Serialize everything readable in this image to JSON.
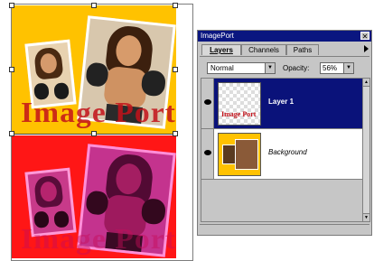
{
  "canvas": {
    "watermark_text": "Image Port"
  },
  "layers_panel": {
    "title": "ImagePort",
    "close_glyph": "✕",
    "tabs": [
      {
        "label": "Layers",
        "active": true
      },
      {
        "label": "Channels",
        "active": false
      },
      {
        "label": "Paths",
        "active": false
      }
    ],
    "menu_icon": "palette-menu-arrow-icon",
    "blend_mode": "Normal",
    "opacity_label": "Opacity:",
    "opacity_value": "56%",
    "layers": [
      {
        "name": "Layer 1",
        "selected": true,
        "visible": true,
        "thumb_text": "Image Port"
      },
      {
        "name": "Background",
        "selected": false,
        "visible": true
      }
    ]
  },
  "colors": {
    "top_layer_bg": "#ffc200",
    "bottom_layer_bg": "#ff1616",
    "watermark_top": "#c4121a",
    "watermark_bottom": "#c80d5a",
    "title_bar": "#0a1680",
    "selected_row": "#0a127a"
  }
}
